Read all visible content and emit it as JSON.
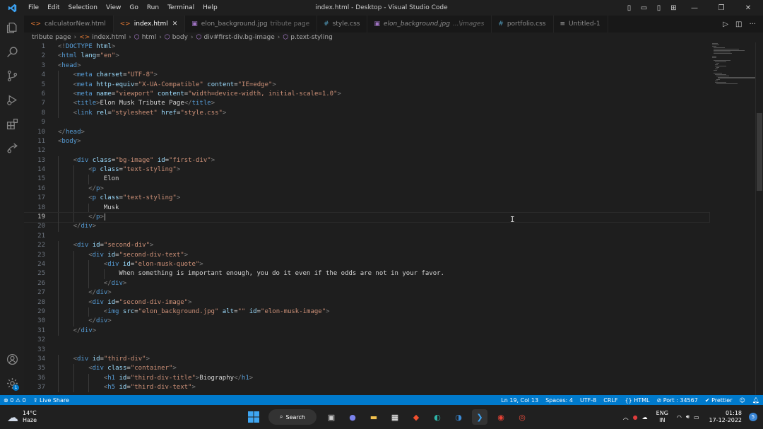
{
  "window": {
    "title": "index.html - Desktop - Visual Studio Code"
  },
  "menu": [
    "File",
    "Edit",
    "Selection",
    "View",
    "Go",
    "Run",
    "Terminal",
    "Help"
  ],
  "tabs": [
    {
      "label": "calculatorNew.html",
      "sub": "",
      "icon": "html-icon",
      "active": false,
      "italic": false,
      "icon_char": "<>",
      "icon_color": "#e37933"
    },
    {
      "label": "index.html",
      "sub": "",
      "icon": "html-icon",
      "active": true,
      "italic": false,
      "icon_char": "<>",
      "icon_color": "#e37933"
    },
    {
      "label": "elon_background.jpg",
      "sub": "tribute page",
      "icon": "image-icon",
      "active": false,
      "italic": false,
      "icon_char": "▣",
      "icon_color": "#a074c4"
    },
    {
      "label": "style.css",
      "sub": "",
      "icon": "css-icon",
      "active": false,
      "italic": false,
      "icon_char": "#",
      "icon_color": "#519aba"
    },
    {
      "label": "elon_background.jpg",
      "sub": "...\\images",
      "icon": "image-icon",
      "active": false,
      "italic": true,
      "icon_char": "▣",
      "icon_color": "#a074c4"
    },
    {
      "label": "portfolio.css",
      "sub": "",
      "icon": "css-icon",
      "active": false,
      "italic": false,
      "icon_char": "#",
      "icon_color": "#519aba"
    },
    {
      "label": "Untitled-1",
      "sub": "",
      "icon": "file-icon",
      "active": false,
      "italic": false,
      "icon_char": "≡",
      "icon_color": "#aaaaaa"
    }
  ],
  "breadcrumb": [
    "tribute page",
    "index.html",
    "html",
    "body",
    "div#first-div.bg-image",
    "p.text-styling"
  ],
  "code_lines": [
    {
      "n": "1",
      "indent": 0,
      "t": [
        [
          "brk",
          "<!"
        ],
        [
          "tag",
          "DOCTYPE"
        ],
        [
          "attr",
          " html"
        ],
        [
          "brk",
          ">"
        ]
      ]
    },
    {
      "n": "2",
      "indent": 0,
      "t": [
        [
          "brk",
          "<"
        ],
        [
          "tag",
          "html"
        ],
        [
          "attr",
          " lang"
        ],
        [
          "txt",
          "="
        ],
        [
          "str",
          "\"en\""
        ],
        [
          "brk",
          ">"
        ]
      ]
    },
    {
      "n": "3",
      "indent": 0,
      "t": [
        [
          "brk",
          "<"
        ],
        [
          "tag",
          "head"
        ],
        [
          "brk",
          ">"
        ]
      ]
    },
    {
      "n": "4",
      "indent": 1,
      "t": [
        [
          "brk",
          "<"
        ],
        [
          "tag",
          "meta"
        ],
        [
          "attr",
          " charset"
        ],
        [
          "txt",
          "="
        ],
        [
          "str",
          "\"UTF-8\""
        ],
        [
          "brk",
          ">"
        ]
      ]
    },
    {
      "n": "5",
      "indent": 1,
      "t": [
        [
          "brk",
          "<"
        ],
        [
          "tag",
          "meta"
        ],
        [
          "attr",
          " http-equiv"
        ],
        [
          "txt",
          "="
        ],
        [
          "str",
          "\"X-UA-Compatible\""
        ],
        [
          "attr",
          " content"
        ],
        [
          "txt",
          "="
        ],
        [
          "str",
          "\"IE=edge\""
        ],
        [
          "brk",
          ">"
        ]
      ]
    },
    {
      "n": "6",
      "indent": 1,
      "t": [
        [
          "brk",
          "<"
        ],
        [
          "tag",
          "meta"
        ],
        [
          "attr",
          " name"
        ],
        [
          "txt",
          "="
        ],
        [
          "str",
          "\"viewport\""
        ],
        [
          "attr",
          " content"
        ],
        [
          "txt",
          "="
        ],
        [
          "str",
          "\"width=device-width, initial-scale=1.0\""
        ],
        [
          "brk",
          ">"
        ]
      ]
    },
    {
      "n": "7",
      "indent": 1,
      "t": [
        [
          "brk",
          "<"
        ],
        [
          "tag",
          "title"
        ],
        [
          "brk",
          ">"
        ],
        [
          "txt",
          "Elon Musk Tribute Page"
        ],
        [
          "brk",
          "</"
        ],
        [
          "tag",
          "title"
        ],
        [
          "brk",
          ">"
        ]
      ]
    },
    {
      "n": "8",
      "indent": 1,
      "t": [
        [
          "brk",
          "<"
        ],
        [
          "tag",
          "link"
        ],
        [
          "attr",
          " rel"
        ],
        [
          "txt",
          "="
        ],
        [
          "str",
          "\"stylesheet\""
        ],
        [
          "attr",
          " href"
        ],
        [
          "txt",
          "="
        ],
        [
          "str",
          "\"style.css\""
        ],
        [
          "brk",
          ">"
        ]
      ]
    },
    {
      "n": "9",
      "indent": 0,
      "t": []
    },
    {
      "n": "10",
      "indent": 0,
      "t": [
        [
          "brk",
          "</"
        ],
        [
          "tag",
          "head"
        ],
        [
          "brk",
          ">"
        ]
      ]
    },
    {
      "n": "11",
      "indent": 0,
      "t": [
        [
          "brk",
          "<"
        ],
        [
          "tag",
          "body"
        ],
        [
          "brk",
          ">"
        ]
      ]
    },
    {
      "n": "12",
      "indent": 0,
      "t": []
    },
    {
      "n": "13",
      "indent": 1,
      "t": [
        [
          "brk",
          "<"
        ],
        [
          "tag",
          "div"
        ],
        [
          "attr",
          " class"
        ],
        [
          "txt",
          "="
        ],
        [
          "str",
          "\"bg-image\""
        ],
        [
          "attr",
          " id"
        ],
        [
          "txt",
          "="
        ],
        [
          "str",
          "\"first-div\""
        ],
        [
          "brk",
          ">"
        ]
      ]
    },
    {
      "n": "14",
      "indent": 2,
      "t": [
        [
          "brk",
          "<"
        ],
        [
          "tag",
          "p"
        ],
        [
          "attr",
          " class"
        ],
        [
          "txt",
          "="
        ],
        [
          "str",
          "\"text-styling\""
        ],
        [
          "brk",
          ">"
        ]
      ]
    },
    {
      "n": "15",
      "indent": 3,
      "t": [
        [
          "txt",
          "Elon"
        ]
      ]
    },
    {
      "n": "16",
      "indent": 2,
      "t": [
        [
          "brk",
          "</"
        ],
        [
          "tag",
          "p"
        ],
        [
          "brk",
          ">"
        ]
      ]
    },
    {
      "n": "17",
      "indent": 2,
      "t": [
        [
          "brk",
          "<"
        ],
        [
          "tag",
          "p"
        ],
        [
          "attr",
          " class"
        ],
        [
          "txt",
          "="
        ],
        [
          "str",
          "\"text-styling\""
        ],
        [
          "brk",
          ">"
        ]
      ]
    },
    {
      "n": "18",
      "indent": 3,
      "t": [
        [
          "txt",
          "Musk"
        ]
      ]
    },
    {
      "n": "19",
      "indent": 2,
      "t": [
        [
          "brk",
          "</"
        ],
        [
          "tag",
          "p"
        ],
        [
          "brk",
          ">"
        ]
      ],
      "current": true
    },
    {
      "n": "20",
      "indent": 1,
      "t": [
        [
          "brk",
          "</"
        ],
        [
          "tag",
          "div"
        ],
        [
          "brk",
          ">"
        ]
      ]
    },
    {
      "n": "21",
      "indent": 0,
      "t": []
    },
    {
      "n": "22",
      "indent": 1,
      "t": [
        [
          "brk",
          "<"
        ],
        [
          "tag",
          "div"
        ],
        [
          "attr",
          " id"
        ],
        [
          "txt",
          "="
        ],
        [
          "str",
          "\"second-div\""
        ],
        [
          "brk",
          ">"
        ]
      ]
    },
    {
      "n": "23",
      "indent": 2,
      "t": [
        [
          "brk",
          "<"
        ],
        [
          "tag",
          "div"
        ],
        [
          "attr",
          " id"
        ],
        [
          "txt",
          "="
        ],
        [
          "str",
          "\"second-div-text\""
        ],
        [
          "brk",
          ">"
        ]
      ]
    },
    {
      "n": "24",
      "indent": 3,
      "t": [
        [
          "brk",
          "<"
        ],
        [
          "tag",
          "div"
        ],
        [
          "attr",
          " id"
        ],
        [
          "txt",
          "="
        ],
        [
          "str",
          "\"elon-musk-quote\""
        ],
        [
          "brk",
          ">"
        ]
      ]
    },
    {
      "n": "25",
      "indent": 4,
      "t": [
        [
          "txt",
          "When something is important enough, you do it even if the odds are not in your favor."
        ]
      ]
    },
    {
      "n": "26",
      "indent": 3,
      "t": [
        [
          "brk",
          "</"
        ],
        [
          "tag",
          "div"
        ],
        [
          "brk",
          ">"
        ]
      ]
    },
    {
      "n": "27",
      "indent": 2,
      "t": [
        [
          "brk",
          "</"
        ],
        [
          "tag",
          "div"
        ],
        [
          "brk",
          ">"
        ]
      ]
    },
    {
      "n": "28",
      "indent": 2,
      "t": [
        [
          "brk",
          "<"
        ],
        [
          "tag",
          "div"
        ],
        [
          "attr",
          " id"
        ],
        [
          "txt",
          "="
        ],
        [
          "str",
          "\"second-div-image\""
        ],
        [
          "brk",
          ">"
        ]
      ]
    },
    {
      "n": "29",
      "indent": 3,
      "t": [
        [
          "brk",
          "<"
        ],
        [
          "tag",
          "img"
        ],
        [
          "attr",
          " src"
        ],
        [
          "txt",
          "="
        ],
        [
          "str",
          "\"elon_background.jpg\""
        ],
        [
          "attr",
          " alt"
        ],
        [
          "txt",
          "="
        ],
        [
          "str",
          "\"\""
        ],
        [
          "attr",
          " id"
        ],
        [
          "txt",
          "="
        ],
        [
          "str",
          "\"elon-musk-image\""
        ],
        [
          "brk",
          ">"
        ]
      ]
    },
    {
      "n": "30",
      "indent": 2,
      "t": [
        [
          "brk",
          "</"
        ],
        [
          "tag",
          "div"
        ],
        [
          "brk",
          ">"
        ]
      ]
    },
    {
      "n": "31",
      "indent": 1,
      "t": [
        [
          "brk",
          "</"
        ],
        [
          "tag",
          "div"
        ],
        [
          "brk",
          ">"
        ]
      ]
    },
    {
      "n": "32",
      "indent": 0,
      "t": []
    },
    {
      "n": "33",
      "indent": 0,
      "t": []
    },
    {
      "n": "34",
      "indent": 1,
      "t": [
        [
          "brk",
          "<"
        ],
        [
          "tag",
          "div"
        ],
        [
          "attr",
          " id"
        ],
        [
          "txt",
          "="
        ],
        [
          "str",
          "\"third-div\""
        ],
        [
          "brk",
          ">"
        ]
      ]
    },
    {
      "n": "35",
      "indent": 2,
      "t": [
        [
          "brk",
          "<"
        ],
        [
          "tag",
          "div"
        ],
        [
          "attr",
          " class"
        ],
        [
          "txt",
          "="
        ],
        [
          "str",
          "\"container\""
        ],
        [
          "brk",
          ">"
        ]
      ]
    },
    {
      "n": "36",
      "indent": 3,
      "t": [
        [
          "brk",
          "<"
        ],
        [
          "tag",
          "h1"
        ],
        [
          "attr",
          " id"
        ],
        [
          "txt",
          "="
        ],
        [
          "str",
          "\"third-div-title\""
        ],
        [
          "brk",
          ">"
        ],
        [
          "txt",
          "Biography"
        ],
        [
          "brk",
          "</"
        ],
        [
          "tag",
          "h1"
        ],
        [
          "brk",
          ">"
        ]
      ]
    },
    {
      "n": "37",
      "indent": 3,
      "t": [
        [
          "brk",
          "<"
        ],
        [
          "tag",
          "h5"
        ],
        [
          "attr",
          " id"
        ],
        [
          "txt",
          "="
        ],
        [
          "str",
          "\"third-div-text\""
        ],
        [
          "brk",
          ">"
        ]
      ]
    }
  ],
  "statusbar": {
    "errors": "0",
    "warnings": "0",
    "live_share": "Live Share",
    "position": "Ln 19, Col 13",
    "spaces": "Spaces: 4",
    "encoding": "UTF-8",
    "eol": "CRLF",
    "language": "HTML",
    "port": "Port : 34567",
    "prettier": "Prettier"
  },
  "taskbar": {
    "temperature": "14°C",
    "weather": "Haze",
    "search": "Search",
    "lang": "ENG",
    "region": "IN",
    "time": "01:18",
    "date": "17-12-2022",
    "notifications": "5"
  },
  "colors": {
    "accent": "#007acc",
    "editor_bg": "#1e1e1e",
    "tab_bar_bg": "#181818"
  }
}
